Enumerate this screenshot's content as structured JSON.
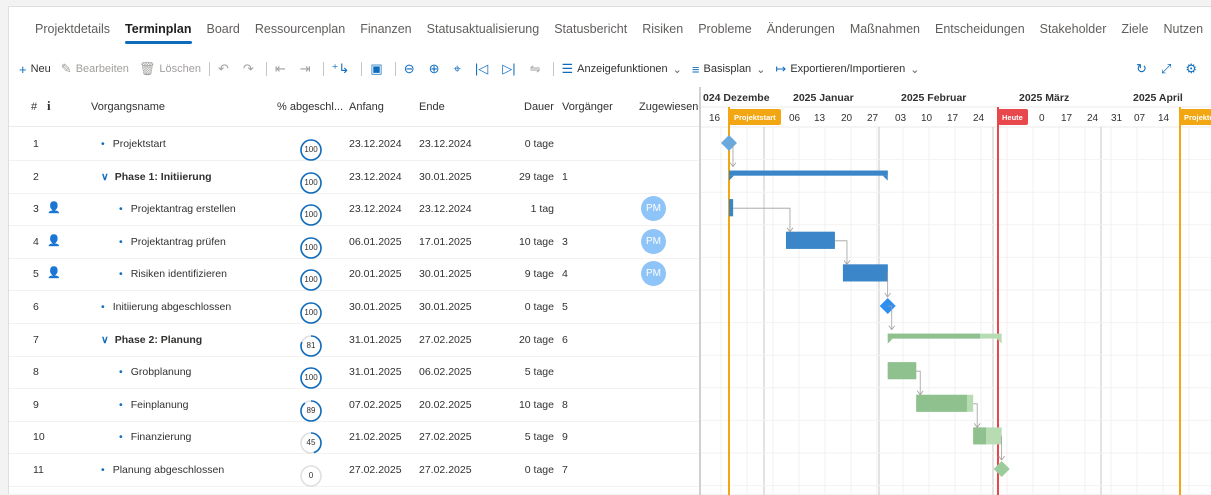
{
  "tabs": [
    "Projektdetails",
    "Terminplan",
    "Board",
    "Ressourcenplan",
    "Finanzen",
    "Statusaktualisierung",
    "Statusbericht",
    "Risiken",
    "Probleme",
    "Änderungen",
    "Maßnahmen",
    "Entscheidungen",
    "Stakeholder",
    "Ziele",
    "Nutzen",
    "···"
  ],
  "active_tab": "Terminplan",
  "toolbar": {
    "new": "Neu",
    "edit": "Bearbeiten",
    "delete": "Löschen",
    "display": "Anzeigefunktionen",
    "baseline": "Basisplan",
    "export": "Exportieren/Importieren"
  },
  "columns": {
    "num": "#",
    "info": "i",
    "name": "Vorgangsname",
    "pct": "% abgeschl...",
    "start": "Anfang",
    "end": "Ende",
    "dur": "Dauer",
    "pred": "Vorgänger",
    "assigned": "Zugewiesen"
  },
  "timeline": {
    "months": [
      "024 Dezembe",
      "2025 Januar",
      "2025 Februar",
      "2025 März",
      "2025 April"
    ],
    "days": [
      "16",
      "06",
      "13",
      "20",
      "27",
      "03",
      "10",
      "17",
      "24",
      "0",
      "17",
      "24",
      "31",
      "07",
      "14"
    ],
    "markers": {
      "projektstart": "Projektstart",
      "heute": "Heute",
      "projektende": "Projektende"
    }
  },
  "rows": [
    {
      "num": "1",
      "name": "Projektstart",
      "pct": 100,
      "start": "23.12.2024",
      "end": "23.12.2024",
      "dur": "0 tage",
      "pred": "",
      "level": 1,
      "summary": false,
      "person": false,
      "assigned": ""
    },
    {
      "num": "2",
      "name": "Phase 1: Initiierung",
      "pct": 100,
      "start": "23.12.2024",
      "end": "30.01.2025",
      "dur": "29 tage",
      "pred": "1",
      "level": 0,
      "summary": true,
      "person": false,
      "assigned": ""
    },
    {
      "num": "3",
      "name": "Projektantrag erstellen",
      "pct": 100,
      "start": "23.12.2024",
      "end": "23.12.2024",
      "dur": "1 tag",
      "pred": "",
      "level": 2,
      "summary": false,
      "person": true,
      "assigned": "PM"
    },
    {
      "num": "4",
      "name": "Projektantrag prüfen",
      "pct": 100,
      "start": "06.01.2025",
      "end": "17.01.2025",
      "dur": "10 tage",
      "pred": "3",
      "level": 2,
      "summary": false,
      "person": true,
      "assigned": "PM"
    },
    {
      "num": "5",
      "name": "Risiken identifizieren",
      "pct": 100,
      "start": "20.01.2025",
      "end": "30.01.2025",
      "dur": "9 tage",
      "pred": "4",
      "level": 2,
      "summary": false,
      "person": true,
      "assigned": "PM"
    },
    {
      "num": "6",
      "name": "Initiierung abgeschlossen",
      "pct": 100,
      "start": "30.01.2025",
      "end": "30.01.2025",
      "dur": "0 tage",
      "pred": "5",
      "level": 1,
      "summary": false,
      "person": false,
      "assigned": ""
    },
    {
      "num": "7",
      "name": "Phase 2: Planung",
      "pct": 81,
      "start": "31.01.2025",
      "end": "27.02.2025",
      "dur": "20 tage",
      "pred": "6",
      "level": 0,
      "summary": true,
      "person": false,
      "assigned": ""
    },
    {
      "num": "8",
      "name": "Grobplanung",
      "pct": 100,
      "start": "31.01.2025",
      "end": "06.02.2025",
      "dur": "5 tage",
      "pred": "",
      "level": 2,
      "summary": false,
      "person": false,
      "assigned": ""
    },
    {
      "num": "9",
      "name": "Feinplanung",
      "pct": 89,
      "start": "07.02.2025",
      "end": "20.02.2025",
      "dur": "10 tage",
      "pred": "8",
      "level": 2,
      "summary": false,
      "person": false,
      "assigned": ""
    },
    {
      "num": "10",
      "name": "Finanzierung",
      "pct": 45,
      "start": "21.02.2025",
      "end": "27.02.2025",
      "dur": "5 tage",
      "pred": "9",
      "level": 2,
      "summary": false,
      "person": false,
      "assigned": ""
    },
    {
      "num": "11",
      "name": "Planung abgeschlossen",
      "pct": 0,
      "start": "27.02.2025",
      "end": "27.02.2025",
      "dur": "0 tage",
      "pred": "7",
      "level": 1,
      "summary": false,
      "person": false,
      "assigned": ""
    }
  ],
  "colors": {
    "accent": "#0f6cbd",
    "phase1": "#3a86c8",
    "phase2": "#8fc18f",
    "phase2_light": "#b7dbb3",
    "today": "#e8474c",
    "milestone_marker": "#f2a712",
    "avatar": "#8ec4f7"
  }
}
